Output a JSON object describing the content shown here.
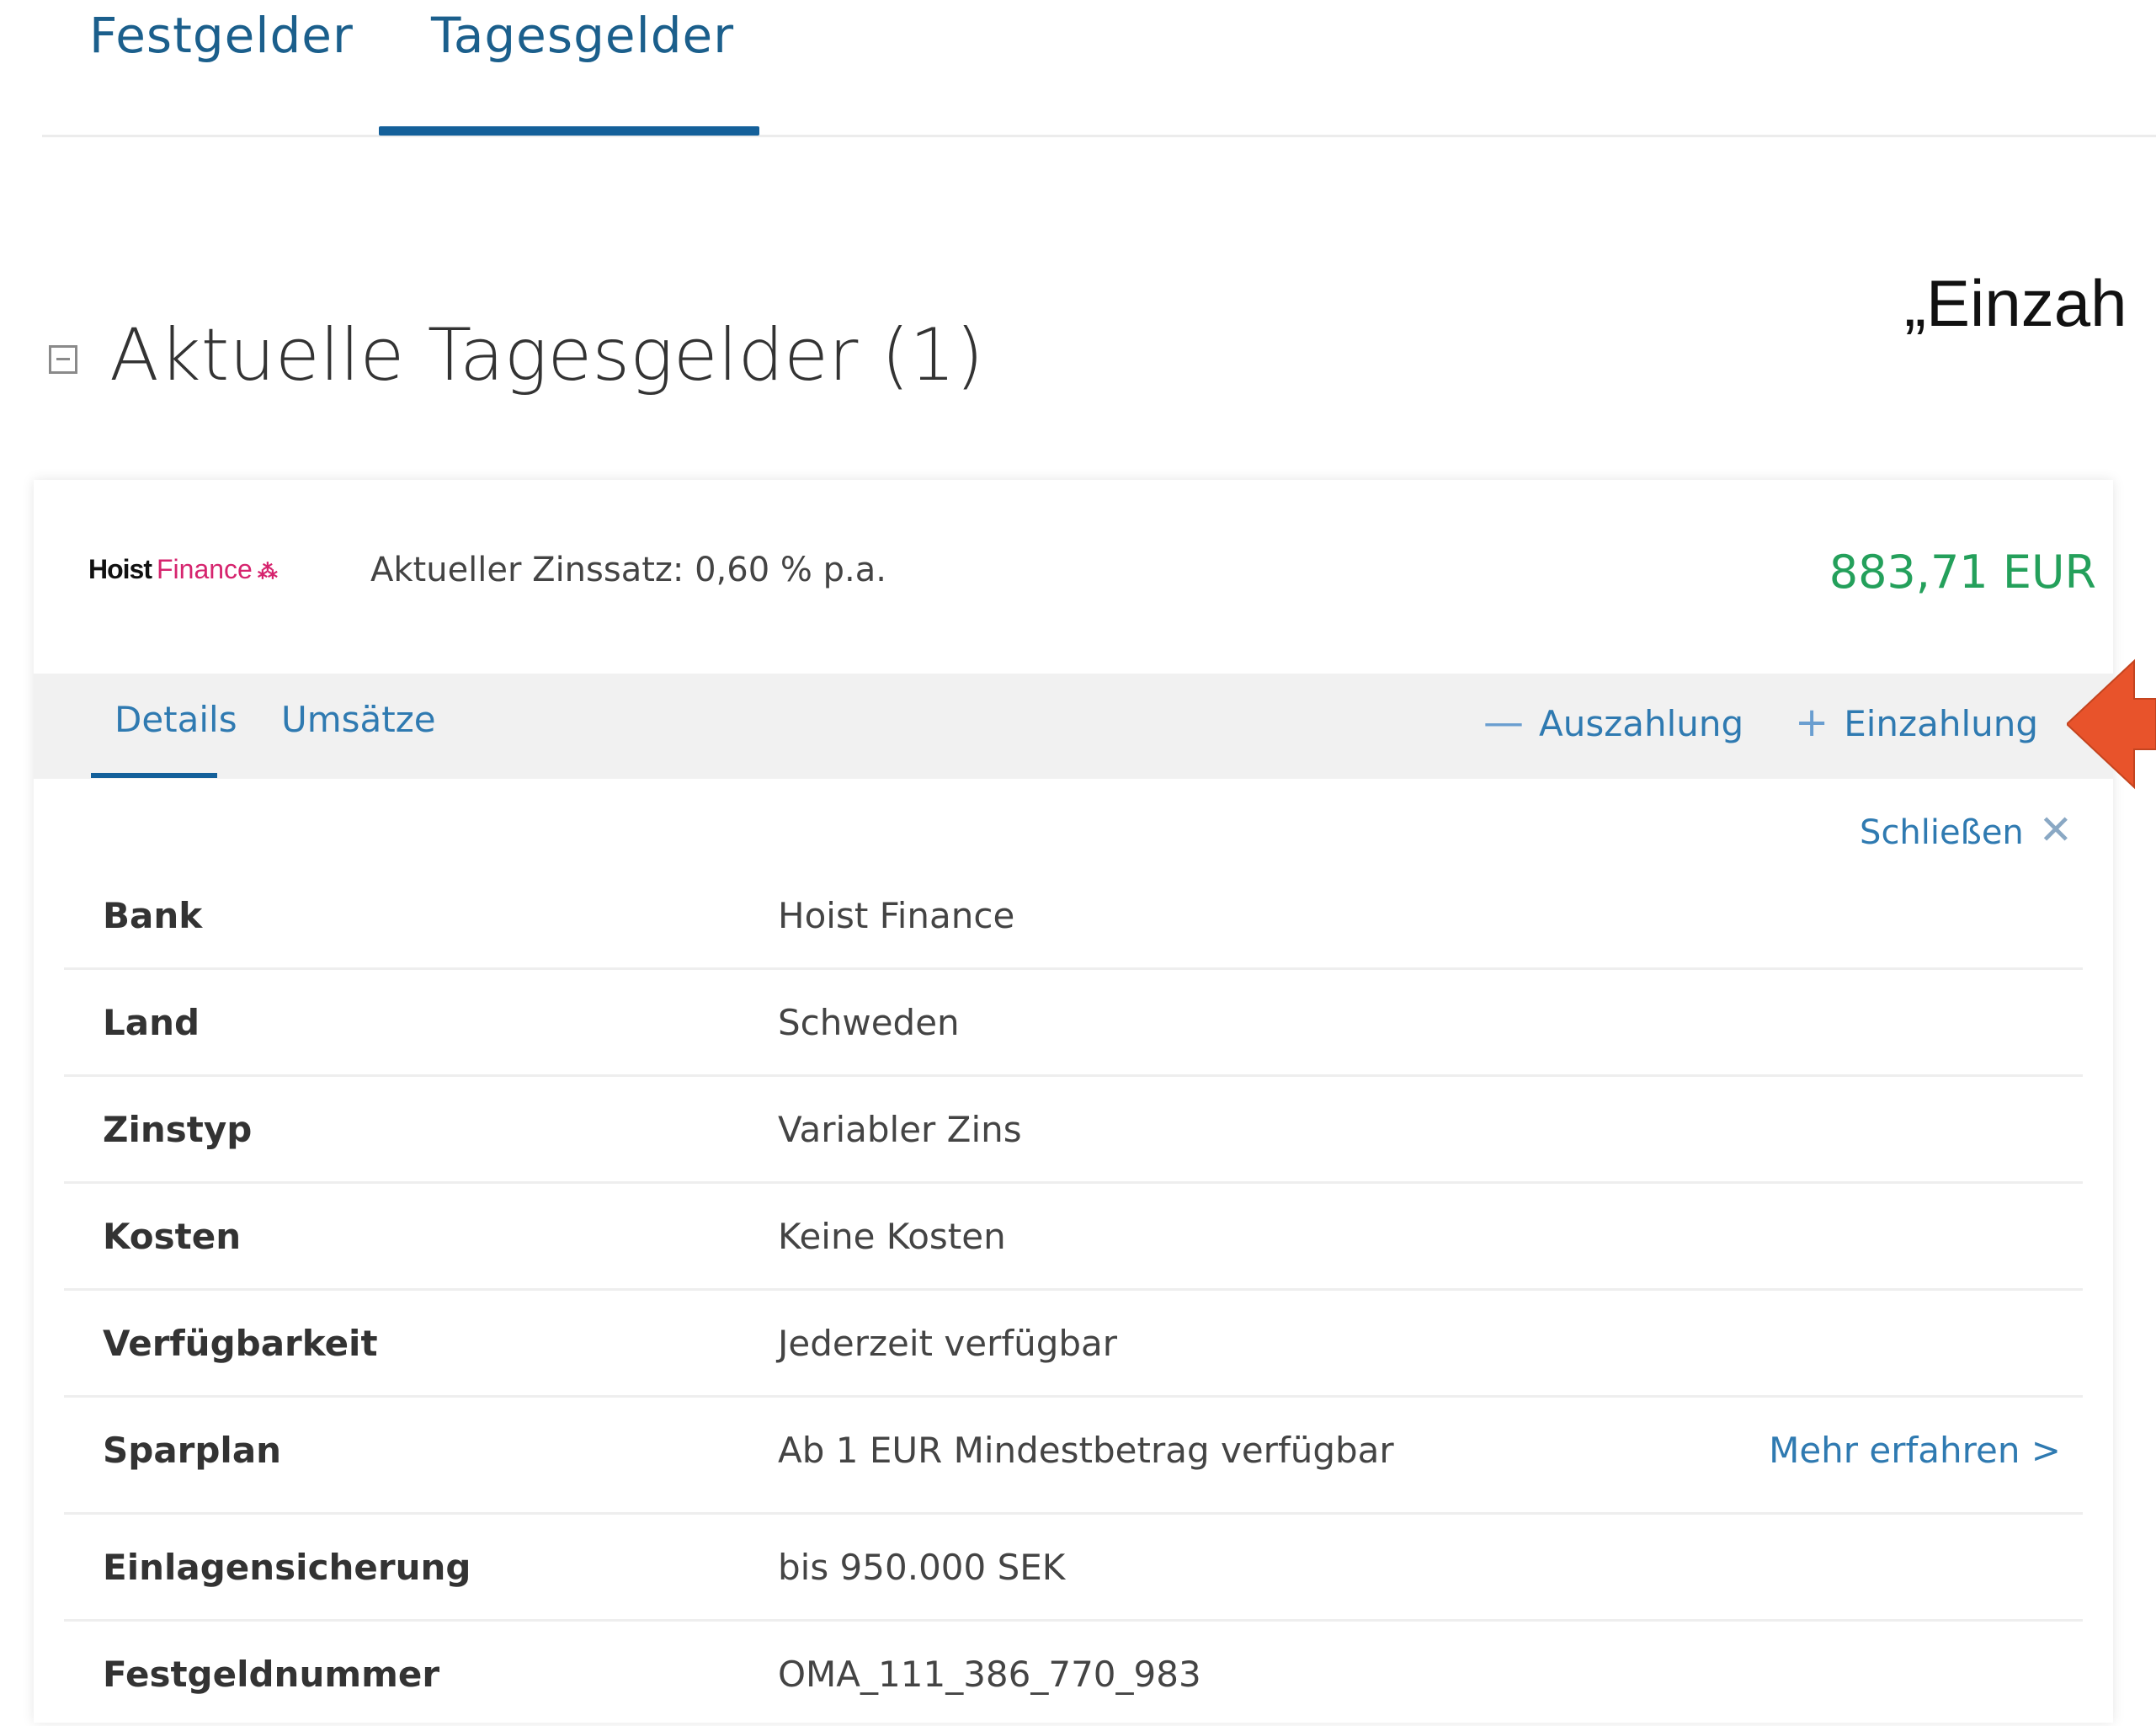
{
  "tabs": [
    {
      "label": "Festgelder",
      "active": false
    },
    {
      "label": "Tagesgelder",
      "active": true
    }
  ],
  "annotation": "„Einzah",
  "section": {
    "title": "Aktuelle Tagesgelder (1)"
  },
  "card": {
    "logo": {
      "part1": "Hoist",
      "part2": "Finance",
      "mark": "⁂"
    },
    "rate": "Aktueller Zinssatz: 0,60 % p.a.",
    "amount": "883,71 EUR",
    "amount_color": "#24a05b",
    "subtabs": [
      {
        "label": "Details",
        "active": true
      },
      {
        "label": "Umsätze",
        "active": false
      }
    ],
    "actions": {
      "payout": {
        "icon": "minus-icon",
        "label": "Auszahlung"
      },
      "deposit": {
        "icon": "plus-icon",
        "label": "Einzahlung"
      }
    },
    "close": {
      "label": "Schließen",
      "icon": "close-icon"
    },
    "rows": [
      {
        "label": "Bank",
        "value": "Hoist Finance"
      },
      {
        "label": "Land",
        "value": "Schweden"
      },
      {
        "label": "Zinstyp",
        "value": "Variabler Zins"
      },
      {
        "label": "Kosten",
        "value": "Keine Kosten"
      },
      {
        "label": "Verfügbarkeit",
        "value": "Jederzeit verfügbar"
      },
      {
        "label": "Sparplan",
        "value": "Ab 1 EUR Mindestbetrag verfügbar",
        "link": "Mehr erfahren >"
      },
      {
        "label": "Einlagensicherung",
        "value": "bis 950.000 SEK"
      },
      {
        "label": "Festgeldnummer",
        "value": "OMA_111_386_770_983"
      }
    ]
  },
  "colors": {
    "accent": "#14609a",
    "link": "#2f7ab1",
    "arrow": "#e8532b",
    "logo_pink": "#d6246e"
  }
}
